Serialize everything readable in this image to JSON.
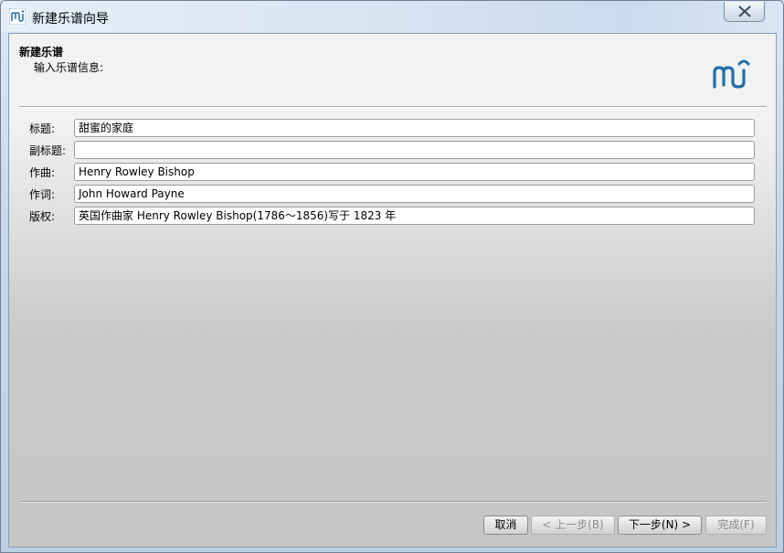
{
  "window": {
    "title": "新建乐谱向导"
  },
  "header": {
    "title": "新建乐谱",
    "subtitle": "输入乐谱信息:"
  },
  "fields": [
    {
      "label": "标题:",
      "value": "甜蜜的家庭"
    },
    {
      "label": "副标题:",
      "value": ""
    },
    {
      "label": "作曲:",
      "value": "Henry Rowley Bishop"
    },
    {
      "label": "作词:",
      "value": "John Howard Payne"
    },
    {
      "label": "版权:",
      "value": "英国作曲家 Henry Rowley Bishop(1786～1856)写于 1823 年"
    }
  ],
  "buttons": {
    "cancel": "取消",
    "back": "< 上一步(B)",
    "next": "下一步(N) >",
    "finish": "完成(F)"
  },
  "colors": {
    "brand": "#1f6fa8"
  }
}
